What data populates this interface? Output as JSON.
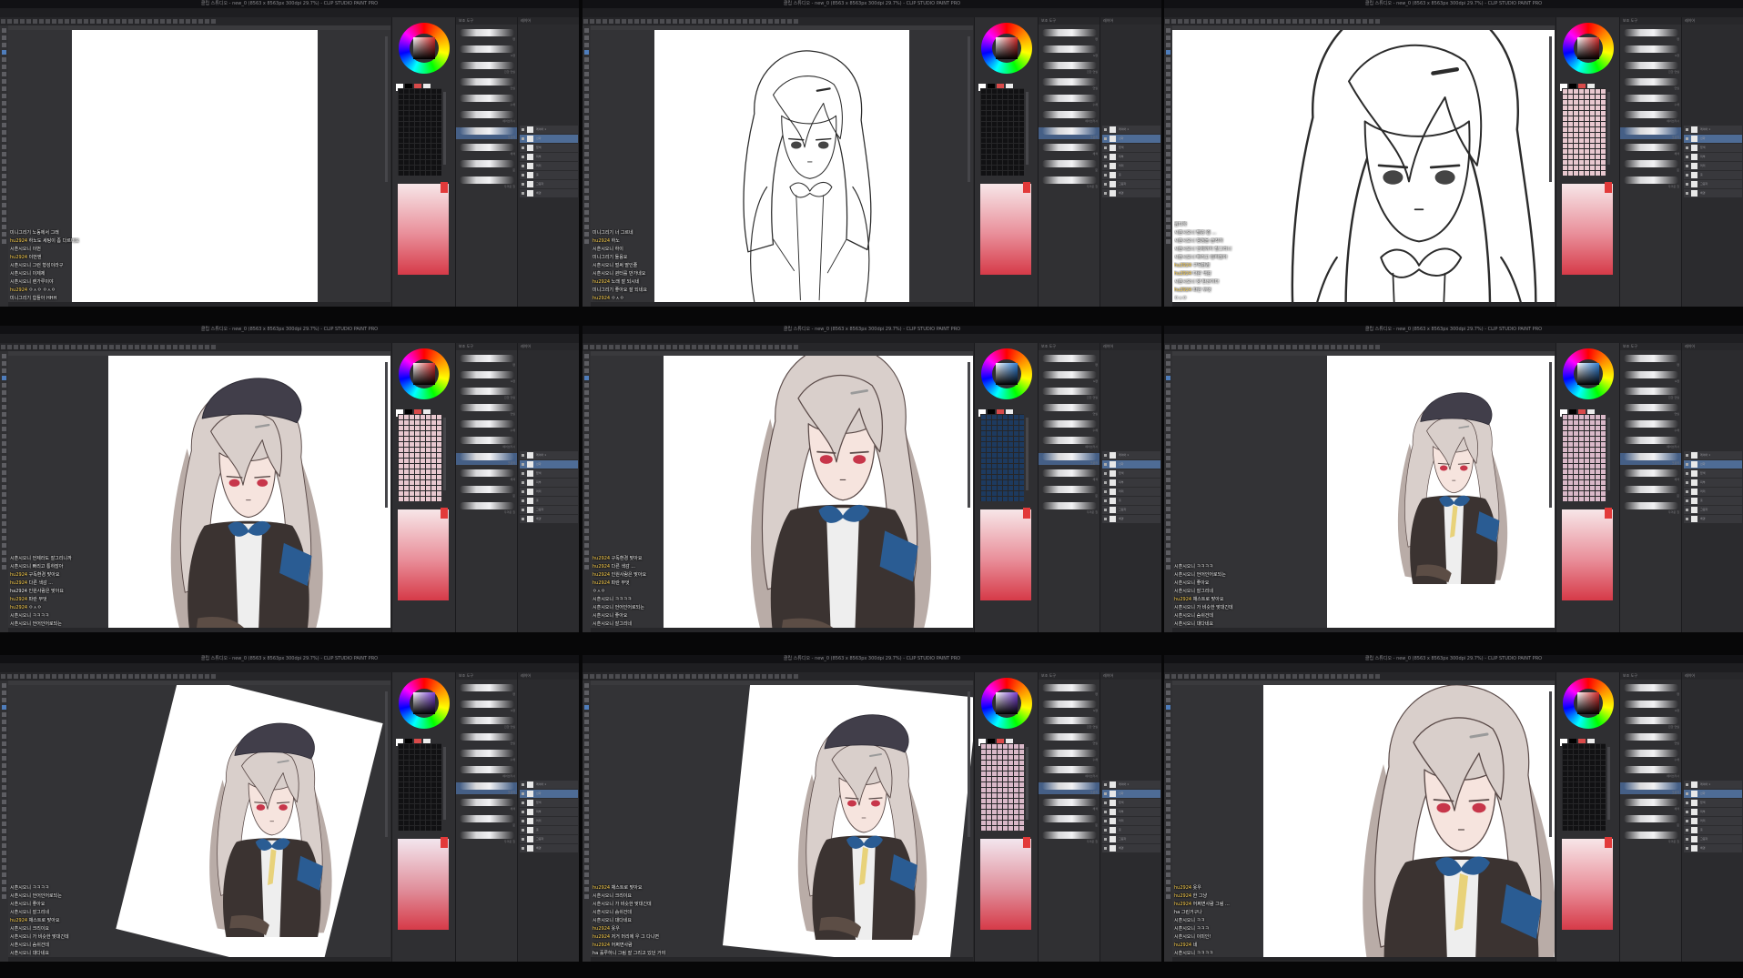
{
  "window": {
    "title": "클립 스튜디오 - new_0 (8563 x 8563px 300dpi 29.7%) - CLIP STUDIO PAINT PRO"
  },
  "menus": [
    "파일",
    "편집",
    "페이지 관리",
    "애니메이션",
    "레이어",
    "선택 범위",
    "보기",
    "필터",
    "창",
    "도움말"
  ],
  "icons": {
    "wheel": "color-wheel-icon",
    "eye": "eye-icon",
    "tool": "tool-icon",
    "close": "close-icon",
    "min": "minimize-icon",
    "max": "maximize-icon"
  },
  "panel_labels": {
    "color": "컬러 써클",
    "brush": "보조 도구",
    "layer": "레이어"
  },
  "brushes": [
    "펜",
    "G펜",
    "진한 연필",
    "연필",
    "수채",
    "에어브러시",
    "크로키",
    "채색",
    "붓",
    "두꺼운 칠"
  ],
  "layers": [
    "레이어 1",
    "선화",
    "밑색",
    "피부",
    "머리",
    "옷",
    "그림자",
    "배경"
  ],
  "colors": {
    "app_bg": "#2a2a2c",
    "accent": "#4e6c96",
    "nick": "#ffd24d"
  },
  "panels": [
    {
      "id": "p1",
      "color_mode": "red",
      "grid_style": "dark",
      "chat": [
        {
          "nick": "",
          "text": "미니그리기 노동에서 그래"
        },
        {
          "nick": "hu2924",
          "text": "하노도 세팅이 좀 다르네요"
        },
        {
          "nick": "",
          "text": "시훈시오니 이번"
        },
        {
          "nick": "hu2924",
          "text": "이번엔"
        },
        {
          "nick": "",
          "text": "시훈시오니 그런 형성이라구"
        },
        {
          "nick": "",
          "text": "시훈시오니 이제제"
        },
        {
          "nick": "",
          "text": "시훈시오니 렌가루이야"
        },
        {
          "nick": "hu2924",
          "text": "ㅇㅅㅇ ㅇㅅㅇ"
        },
        {
          "nick": "",
          "text": "미니그리기 힘들아 HHH"
        }
      ]
    },
    {
      "id": "p2",
      "color_mode": "red",
      "grid_style": "dark",
      "chat": [
        {
          "nick": "",
          "text": "미니그리기 너 그르네"
        },
        {
          "nick": "hu2924",
          "text": "하노"
        },
        {
          "nick": "",
          "text": "시훈시오니 하이"
        },
        {
          "nick": "",
          "text": "미니그리기 둘음요"
        },
        {
          "nick": "",
          "text": "시훈시오니 벌써 딸인줄"
        },
        {
          "nick": "",
          "text": "시훈시오니 퀸터를 만가네요"
        },
        {
          "nick": "hu2924",
          "text": "노래 잘 되시네"
        },
        {
          "nick": "",
          "text": "미니그리기 좋아요 잘 되네요"
        },
        {
          "nick": "hu2924",
          "text": "ㅇㅅㅇ"
        }
      ]
    },
    {
      "id": "p3",
      "color_mode": "red",
      "grid_style": "tinted",
      "chat": [
        {
          "nick": "",
          "text": "쌈디하"
        },
        {
          "nick": "",
          "text": "시훈시오니 빨강 좀 ..."
        },
        {
          "nick": "",
          "text": "시훈시오니 평정을 솔직히"
        },
        {
          "nick": "",
          "text": "시훈시오니 언제까지 할그리니"
        },
        {
          "nick": "",
          "text": "시훈시오니 빠리고 통하잖아"
        },
        {
          "nick": "hu2924",
          "text": "구독환경"
        },
        {
          "nick": "hu2924",
          "text": "다른 색감"
        },
        {
          "nick": "",
          "text": "시훈시오니 양 탄산이다"
        },
        {
          "nick": "hu2924",
          "text": "파란 무엇"
        },
        {
          "nick": "",
          "text": "ㅇㅅㅇ"
        }
      ]
    },
    {
      "id": "p4",
      "color_mode": "red",
      "grid_style": "tinted",
      "chat": [
        {
          "nick": "",
          "text": "시훈시오니 언제라도 잘그리니까"
        },
        {
          "nick": "",
          "text": "시훈시오니 빠리고 통하잖아"
        },
        {
          "nick": "hu2924",
          "text": "구독환경 맞아요"
        },
        {
          "nick": "hu2924",
          "text": "다른 색감 ..."
        },
        {
          "nick": "",
          "text": "ha2924 인원사람은 맞아요"
        },
        {
          "nick": "hu2924",
          "text": "파란 무엇"
        },
        {
          "nick": "hu2924",
          "text": "ㅇㅅㅇ"
        },
        {
          "nick": "",
          "text": "시훈시오니 ㅋㅋㅋㅋ"
        },
        {
          "nick": "",
          "text": "시훈시오니 언어인어로되는"
        }
      ]
    },
    {
      "id": "p5",
      "color_mode": "blue",
      "grid_style": "blue",
      "chat": [
        {
          "nick": "hu2924",
          "text": "구독환경 맞아요"
        },
        {
          "nick": "hu2924",
          "text": "다른 색감 ..."
        },
        {
          "nick": "hu2924",
          "text": "인원사람은 맞아요"
        },
        {
          "nick": "hu2924",
          "text": "파란 무엇"
        },
        {
          "nick": "",
          "text": "ㅇㅅㅇ"
        },
        {
          "nick": "",
          "text": "시훈시오니 ㅋㅋㅋㅋ"
        },
        {
          "nick": "",
          "text": "시훈시오니 언어인어로되는"
        },
        {
          "nick": "",
          "text": "시훈시오니 좋아요"
        },
        {
          "nick": "",
          "text": "시훈시오니 잘그리네"
        }
      ]
    },
    {
      "id": "p6",
      "color_mode": "blue",
      "grid_style": "mix",
      "chat": [
        {
          "nick": "",
          "text": "시훈시오니 ㅋㅋㅋㅋ"
        },
        {
          "nick": "",
          "text": "시훈시오니 언어인어로되는"
        },
        {
          "nick": "",
          "text": "시훈시오니 좋아요"
        },
        {
          "nick": "",
          "text": "시훈시오니 잘그리네"
        },
        {
          "nick": "hu2924",
          "text": "채스트로 맞아요"
        },
        {
          "nick": "",
          "text": "시훈시오니 가 비슷한 맞대긴데"
        },
        {
          "nick": "",
          "text": "시훈시오니 숨쉬건데"
        },
        {
          "nick": "",
          "text": "시훈시오니 대다네요"
        }
      ]
    },
    {
      "id": "p7",
      "color_mode": "purple",
      "grid_style": "dark",
      "chat": [
        {
          "nick": "",
          "text": "시훈시오니 ㅋㅋㅋㅋ"
        },
        {
          "nick": "",
          "text": "시훈시오니 언어인어로되는"
        },
        {
          "nick": "",
          "text": "시훈시오니 좋아요"
        },
        {
          "nick": "",
          "text": "시훈시오니 잘그리네"
        },
        {
          "nick": "hu2924",
          "text": "채스트로 맞아요"
        },
        {
          "nick": "",
          "text": "시훈시오니 크리이요"
        },
        {
          "nick": "",
          "text": "시훈시오니 가 비슷한 맞대긴데"
        },
        {
          "nick": "",
          "text": "시훈시오니 숨쉬건데"
        },
        {
          "nick": "",
          "text": "시훈시오니 대다네요"
        }
      ]
    },
    {
      "id": "p8",
      "color_mode": "purple",
      "grid_style": "mix",
      "chat": [
        {
          "nick": "hu2924",
          "text": "채스트로 맞아요"
        },
        {
          "nick": "",
          "text": "시훈시오니 크리이요"
        },
        {
          "nick": "",
          "text": "시훈시오니 가 비슷한 맞대긴데"
        },
        {
          "nick": "",
          "text": "시훈시오니 숨쉬건데"
        },
        {
          "nick": "",
          "text": "시훈시오니 대다네요"
        },
        {
          "nick": "hu2924",
          "text": "옷우"
        },
        {
          "nick": "hu2924",
          "text": "저거 머리에 우 그 다니면"
        },
        {
          "nick": "hu2924",
          "text": "어쩌면사람"
        },
        {
          "nick": "",
          "text": "ha 훌루하니 그림 잘 그리고 있던 거야"
        }
      ]
    },
    {
      "id": "p9",
      "color_mode": "red",
      "grid_style": "dark",
      "chat": [
        {
          "nick": "hu2924",
          "text": "옷우"
        },
        {
          "nick": "hu2924",
          "text": "한 그냥"
        },
        {
          "nick": "hu2924",
          "text": "어쩌면사람 그림 ..."
        },
        {
          "nick": "",
          "text": "ha 그린거구나"
        },
        {
          "nick": "",
          "text": "시훈시오니 ㅋㅋ"
        },
        {
          "nick": "",
          "text": "시훈시오니 ㅋㅋㅋ"
        },
        {
          "nick": "",
          "text": "시훈시오니 이미인!"
        },
        {
          "nick": "hu2924",
          "text": "네"
        },
        {
          "nick": "",
          "text": "시훈시오니 ㅋㅋㅋㅋ"
        }
      ]
    }
  ]
}
